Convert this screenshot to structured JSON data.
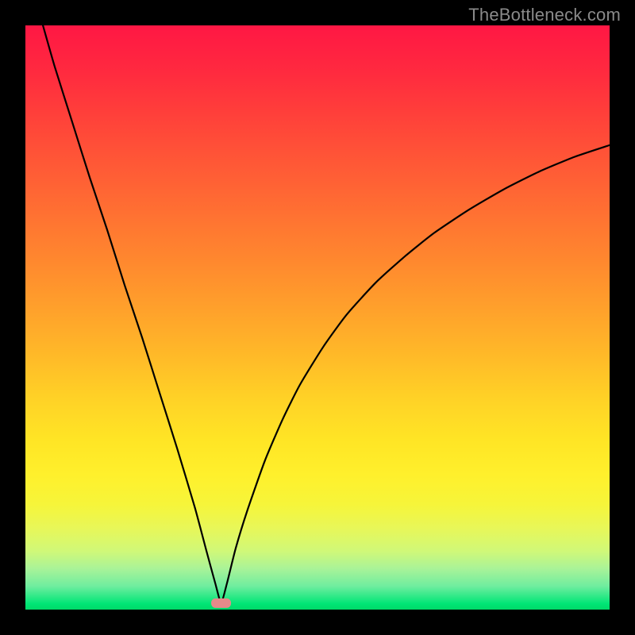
{
  "watermark": "TheBottleneck.com",
  "chart_data": {
    "type": "line",
    "title": "",
    "xlabel": "",
    "ylabel": "",
    "xlim": [
      0,
      100
    ],
    "ylim": [
      0,
      100
    ],
    "grid": false,
    "marker": {
      "x": 33.5,
      "y": 1.1
    },
    "series": [
      {
        "name": "bottleneck-curve",
        "x": [
          3,
          5,
          8,
          11,
          14,
          17,
          20,
          23,
          26,
          29,
          31,
          32.5,
          33.5,
          34.5,
          36,
          38,
          41,
          44,
          47,
          51,
          55,
          60,
          65,
          70,
          76,
          82,
          88,
          94,
          100
        ],
        "values": [
          100,
          93,
          83.5,
          74,
          65,
          55.5,
          46.5,
          37,
          27.5,
          17.5,
          10,
          4.5,
          1.2,
          4.5,
          10.5,
          17,
          25.5,
          32.5,
          38.5,
          45,
          50.5,
          56,
          60.5,
          64.5,
          68.5,
          72,
          75,
          77.5,
          79.5
        ]
      }
    ]
  }
}
